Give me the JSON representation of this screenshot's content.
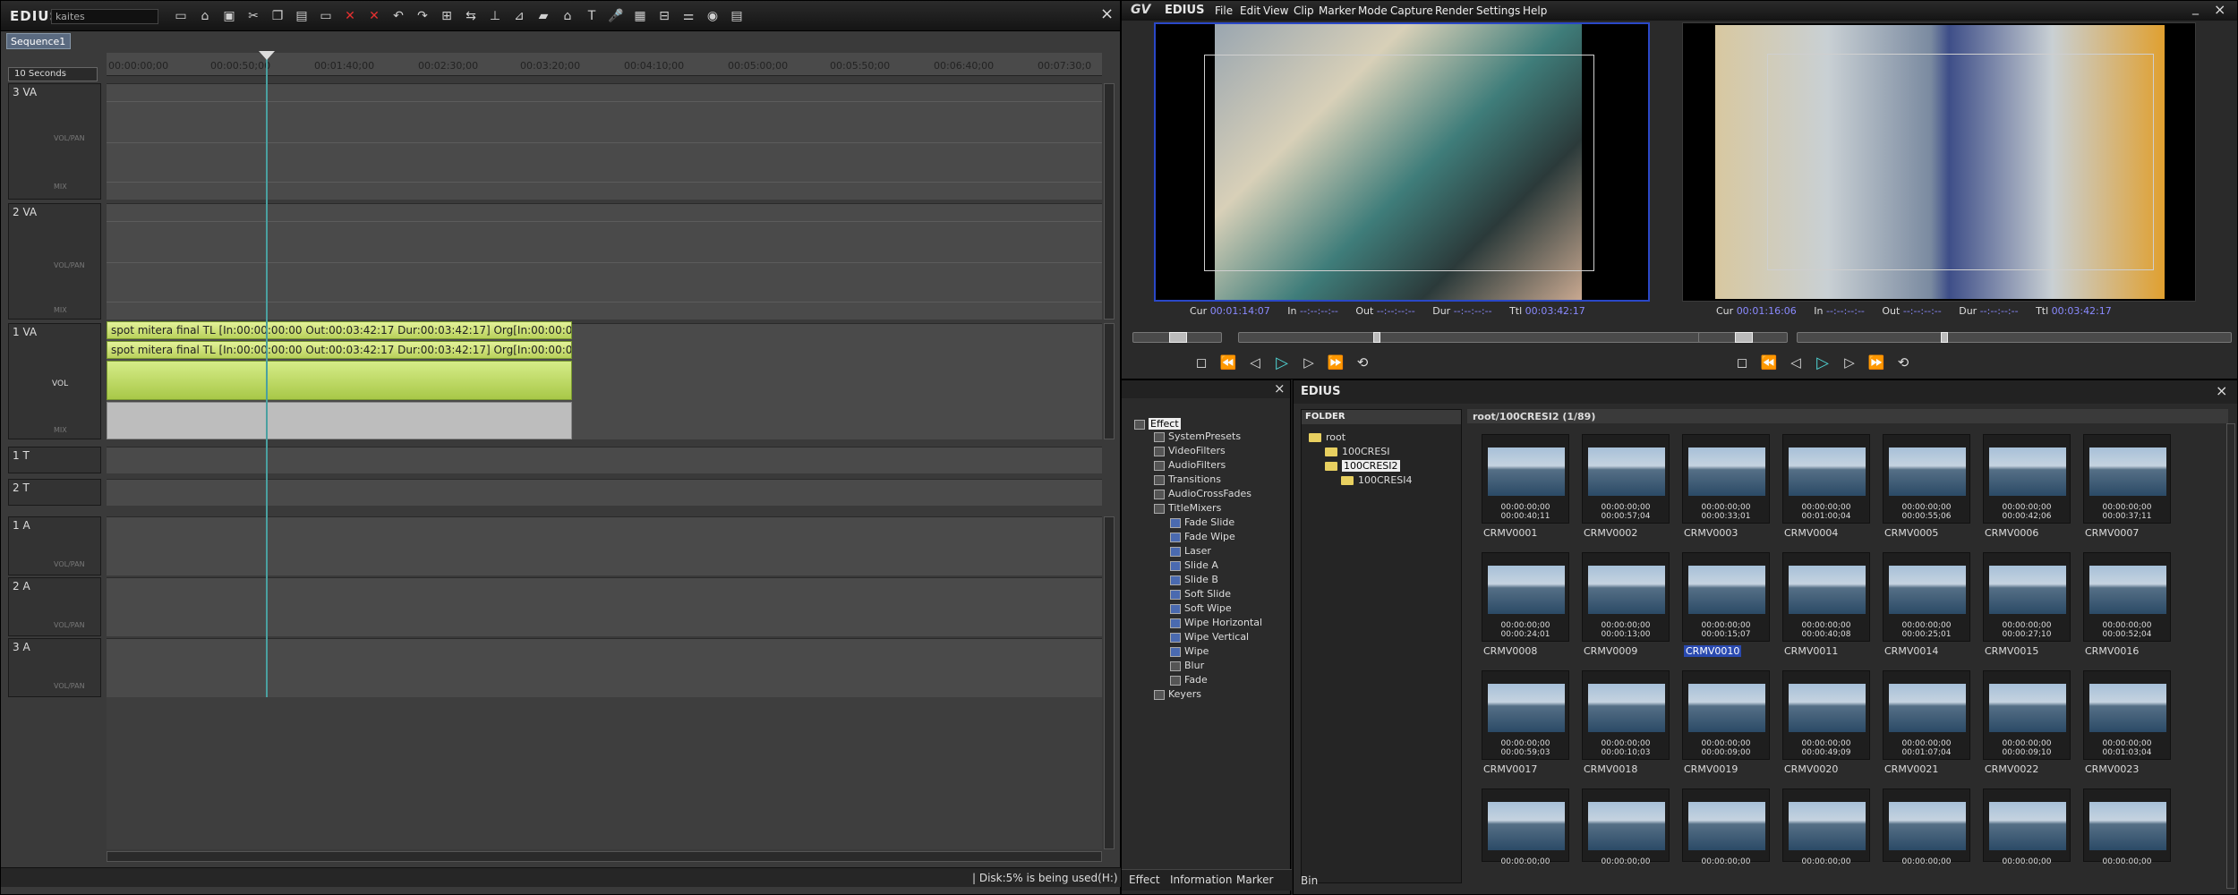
{
  "left_window": {
    "logo": "EDIUS",
    "project_name": "kaites",
    "sequence_tab": "Sequence1",
    "scale": "10 Seconds",
    "close": "×"
  },
  "ruler": {
    "ticks": [
      "00:00:00;00",
      "00:00:50;00",
      "00:01:40;00",
      "00:02:30;00",
      "00:03:20;00",
      "00:04:10;00",
      "00:05:00;00",
      "00:05:50;00",
      "00:06:40;00",
      "00:07:30;0"
    ]
  },
  "tracks": [
    {
      "name": "3 VA",
      "sub1": "VOL/PAN",
      "sub2": "MIX"
    },
    {
      "name": "2 VA",
      "sub1": "VOL/PAN",
      "sub2": "MIX"
    },
    {
      "name": "1 VA",
      "sub1": "VOL",
      "sub2": "MIX"
    },
    {
      "name": "1 T"
    },
    {
      "name": "2 T"
    },
    {
      "name": "1 A",
      "sub1": "VOL/PAN"
    },
    {
      "name": "2 A",
      "sub1": "VOL/PAN"
    },
    {
      "name": "3 A",
      "sub1": "VOL/PAN"
    }
  ],
  "clips": {
    "video": "spot mitera final  TL [In:00:00:00:00 Out:00:03:42:17 Dur:00:03:42:17]  Org[In:00:00:00:00...",
    "audio": "spot mitera final  TL [In:00:00:00:00 Out:00:03:42:17 Dur:00:03:42:17]  Org[In:00:00:00:00..."
  },
  "status": {
    "disk": "| Disk:5% is being used(H:)"
  },
  "preview": {
    "logo": "EDIUS",
    "menu": [
      "File",
      "Edit",
      "View",
      "Clip",
      "Marker",
      "Mode",
      "Capture",
      "Render",
      "Settings",
      "Help"
    ],
    "player": {
      "cur": "00:01:14:07",
      "in": "--:--:--:--",
      "out": "--:--:--:--",
      "dur": "--:--:--:--",
      "ttl": "00:03:42:17"
    },
    "recorder": {
      "cur": "00:01:16:06",
      "in": "--:--:--:--",
      "out": "--:--:--:--",
      "dur": "--:--:--:--",
      "ttl": "00:03:42:17"
    },
    "labels": {
      "cur": "Cur",
      "in": "In",
      "out": "Out",
      "dur": "Dur",
      "ttl": "Ttl"
    }
  },
  "effect": {
    "root": "Effect",
    "items": [
      "SystemPresets",
      "VideoFilters",
      "AudioFilters",
      "Transitions",
      "AudioCrossFades",
      "TitleMixers",
      "Fade Slide",
      "Fade Wipe",
      "Laser",
      "Slide A",
      "Slide B",
      "Soft Slide",
      "Soft Wipe",
      "Wipe Horizontal",
      "Wipe Vertical",
      "Wipe",
      "Blur",
      "Fade",
      "Keyers"
    ],
    "tabs": [
      "Effect",
      "Information",
      "Marker"
    ]
  },
  "bin": {
    "logo": "EDIUS",
    "folder_header": "FOLDER",
    "folders": [
      "root",
      "100CRESI",
      "100CRESI2",
      "100CRESI4"
    ],
    "path": "root/100CRESI2 (1/89)",
    "tab": "Bin",
    "clips": [
      {
        "name": "CRMV0001",
        "tc": "00:00:00;00",
        "dur": "00:00:40;11"
      },
      {
        "name": "CRMV0002",
        "tc": "00:00:00;00",
        "dur": "00:00:57;04"
      },
      {
        "name": "CRMV0003",
        "tc": "00:00:00;00",
        "dur": "00:00:33;01"
      },
      {
        "name": "CRMV0004",
        "tc": "00:00:00;00",
        "dur": "00:01:00;04"
      },
      {
        "name": "CRMV0005",
        "tc": "00:00:00;00",
        "dur": "00:00:55;06"
      },
      {
        "name": "CRMV0006",
        "tc": "00:00:00;00",
        "dur": "00:00:42;06"
      },
      {
        "name": "CRMV0007",
        "tc": "00:00:00;00",
        "dur": "00:00:37;11"
      },
      {
        "name": "CRMV0008",
        "tc": "00:00:00;00",
        "dur": "00:00:24;01"
      },
      {
        "name": "CRMV0009",
        "tc": "00:00:00;00",
        "dur": "00:00:13;00"
      },
      {
        "name": "CRMV0010",
        "tc": "00:00:00;00",
        "dur": "00:00:15;07"
      },
      {
        "name": "CRMV0011",
        "tc": "00:00:00;00",
        "dur": "00:00:40;08"
      },
      {
        "name": "CRMV0014",
        "tc": "00:00:00;00",
        "dur": "00:00:25;01"
      },
      {
        "name": "CRMV0015",
        "tc": "00:00:00;00",
        "dur": "00:00:27;10"
      },
      {
        "name": "CRMV0016",
        "tc": "00:00:00;00",
        "dur": "00:00:52;04"
      },
      {
        "name": "CRMV0017",
        "tc": "00:00:00;00",
        "dur": "00:00:59;03"
      },
      {
        "name": "CRMV0018",
        "tc": "00:00:00;00",
        "dur": "00:00:10;03"
      },
      {
        "name": "CRMV0019",
        "tc": "00:00:00;00",
        "dur": "00:00:09;00"
      },
      {
        "name": "CRMV0020",
        "tc": "00:00:00;00",
        "dur": "00:00:49;09"
      },
      {
        "name": "CRMV0021",
        "tc": "00:00:00;00",
        "dur": "00:01:07;04"
      },
      {
        "name": "CRMV0022",
        "tc": "00:00:00;00",
        "dur": "00:00:09;10"
      },
      {
        "name": "CRMV0023",
        "tc": "00:00:00;00",
        "dur": "00:01:03;04"
      },
      {
        "name": "",
        "tc": "00:00:00;00",
        "dur": ""
      },
      {
        "name": "",
        "tc": "00:00:00;00",
        "dur": ""
      },
      {
        "name": "",
        "tc": "00:00:00;00",
        "dur": ""
      },
      {
        "name": "",
        "tc": "00:00:00;00",
        "dur": ""
      },
      {
        "name": "",
        "tc": "00:00:00;00",
        "dur": ""
      },
      {
        "name": "",
        "tc": "00:00:00;00",
        "dur": ""
      },
      {
        "name": "",
        "tc": "00:00:00;00",
        "dur": ""
      }
    ]
  },
  "colors": {
    "accent": "#2a48c8",
    "clip": "#c8e070",
    "play": "#4fd0d0",
    "close": "#e53030"
  }
}
